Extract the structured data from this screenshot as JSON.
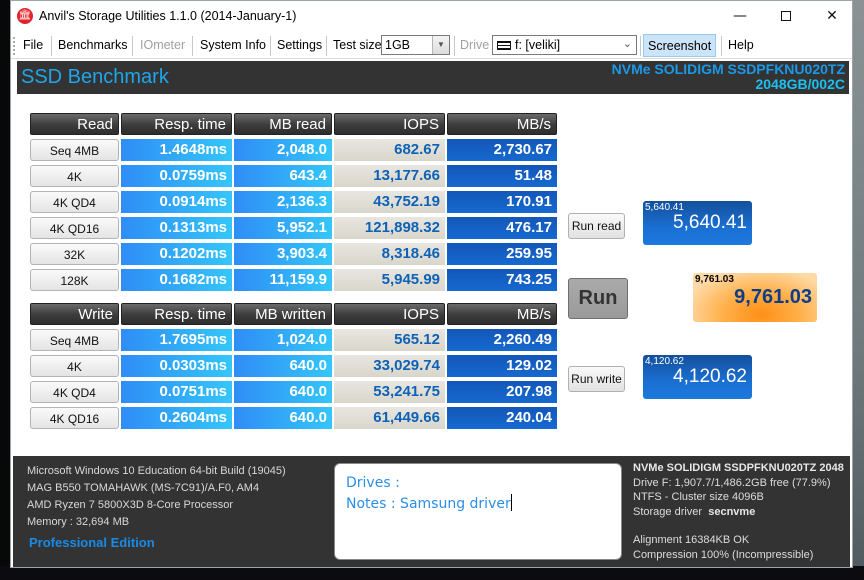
{
  "window": {
    "title": "Anvil's Storage Utilities 1.1.0 (2014-January-1)",
    "minimize_label": "—",
    "close_label": "✕",
    "app_icon": "anvil-temple-icon"
  },
  "toolbar": {
    "file": "File",
    "benchmarks": "Benchmarks",
    "iometer": "IOmeter",
    "system_info": "System Info",
    "settings": "Settings",
    "test_size_label": "Test size",
    "test_size_value": "1GB",
    "drive_label": "Drive",
    "drive_value": "f: [veliki]",
    "screenshot": "Screenshot",
    "help": "Help"
  },
  "header": {
    "title": "SSD Benchmark",
    "drive_line1": "NVMe  SOLIDIGM  SSDPFKNU020TZ",
    "drive_line2": "2048GB/002C"
  },
  "read": {
    "headers": [
      "Read",
      "Resp. time",
      "MB read",
      "IOPS",
      "MB/s"
    ],
    "rows": [
      {
        "label": "Seq 4MB",
        "resp": "1.4648ms",
        "mb": "2,048.0",
        "iops": "682.67",
        "mbs": "2,730.67"
      },
      {
        "label": "4K",
        "resp": "0.0759ms",
        "mb": "643.4",
        "iops": "13,177.66",
        "mbs": "51.48"
      },
      {
        "label": "4K QD4",
        "resp": "0.0914ms",
        "mb": "2,136.3",
        "iops": "43,752.19",
        "mbs": "170.91"
      },
      {
        "label": "4K QD16",
        "resp": "0.1313ms",
        "mb": "5,952.1",
        "iops": "121,898.32",
        "mbs": "476.17"
      },
      {
        "label": "32K",
        "resp": "0.1202ms",
        "mb": "3,903.4",
        "iops": "8,318.46",
        "mbs": "259.95"
      },
      {
        "label": "128K",
        "resp": "0.1682ms",
        "mb": "11,159.9",
        "iops": "5,945.99",
        "mbs": "743.25"
      }
    ]
  },
  "write": {
    "headers": [
      "Write",
      "Resp. time",
      "MB written",
      "IOPS",
      "MB/s"
    ],
    "rows": [
      {
        "label": "Seq 4MB",
        "resp": "1.7695ms",
        "mb": "1,024.0",
        "iops": "565.12",
        "mbs": "2,260.49"
      },
      {
        "label": "4K",
        "resp": "0.0303ms",
        "mb": "640.0",
        "iops": "33,029.74",
        "mbs": "129.02"
      },
      {
        "label": "4K QD4",
        "resp": "0.0751ms",
        "mb": "640.0",
        "iops": "53,241.75",
        "mbs": "207.98"
      },
      {
        "label": "4K QD16",
        "resp": "0.2604ms",
        "mb": "640.0",
        "iops": "61,449.66",
        "mbs": "240.04"
      }
    ]
  },
  "controls": {
    "run_read": "Run read",
    "run": "Run",
    "run_write": "Run write"
  },
  "scores": {
    "read_small": "5,640.41",
    "read_big": "5,640.41",
    "total_small": "9,761.03",
    "total_big": "9,761.03",
    "write_small": "4,120.62",
    "write_big": "4,120.62"
  },
  "system": {
    "os": "Microsoft Windows 10 Education 64-bit Build (19045)",
    "board": "MAG B550 TOMAHAWK (MS-7C91)/A.F0, AM4",
    "cpu": "AMD Ryzen 7 5800X3D 8-Core Processor",
    "memory": "Memory : 32,694 MB",
    "edition": "Professional Edition"
  },
  "notes": {
    "drives": "Drives :",
    "notes": "Notes : Samsung driver"
  },
  "drive_info": {
    "model": "NVMe SOLIDIGM SSDPFKNU020TZ 2048",
    "space": "Drive F: 1,907.7/1,486.2GB free (77.9%)",
    "fs": "NTFS - Cluster size 4096B",
    "driver_label": "Storage driver",
    "driver_value": "secnvme",
    "alignment": "Alignment 16384KB OK",
    "compression": "Compression 100% (Incompressible)"
  }
}
